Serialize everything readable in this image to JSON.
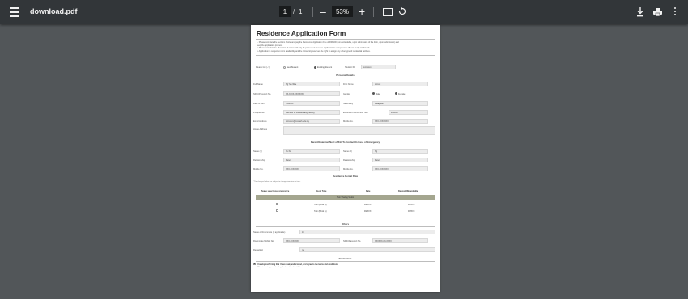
{
  "viewer": {
    "file_name": "download.pdf",
    "current_page": "1",
    "page_separator": "/",
    "total_pages": "1",
    "zoom": "53%",
    "zoom_out_symbol": "–",
    "zoom_in_symbol": "+"
  },
  "form": {
    "title": "Residence Application Form",
    "instructions": [
      "1. Please complete the sections below and pay the Residence Application Fee of RM 100 (non-refundable, upon submission of the form, upon submission) and",
      "   keep the application process.",
      "2. Please note that the allocation of rooms will only be processed once the applicant has accepted an offer to study at Monash.",
      "3. Application is subject to room availability and the University reserves the right to assign any other type of residential facilities."
    ],
    "applicant_type": {
      "label": "Please tick (✓)",
      "options": [
        "New Student",
        "Existing Student"
      ],
      "student_id_label": "Student ID",
      "student_id_value": "xxxxxxxx"
    },
    "personal": {
      "title": "Personal Details",
      "full_name_label": "Full Name",
      "full_name": "Ng Yee Wee",
      "first_name_label": "First Name",
      "first_name": "xxxxxx",
      "nric_label": "NRIC/Passport No.",
      "nric": "XX-XXXX-XXX-XXXX",
      "gender_label": "Gender",
      "gender_options": [
        "Male",
        "Female"
      ],
      "dob_label": "Date of Birth",
      "dob": "7/8/2000",
      "nationality_label": "Nationality",
      "nationality": "Malaysian",
      "programme_label": "Programme",
      "programme": "Bachelor in Software Engineering",
      "enrolment_label": "Enrolment Month and Year",
      "enrolment": "2019/16",
      "email_label": "Email Address",
      "email": "xxxxxxxx@monash.edu.my",
      "mobile_label": "Mobile No.",
      "mobile": "XXX-XXXXXXX",
      "home_label": "Home Address",
      "home": ""
    },
    "guardian": {
      "title": "Parent/Guardian/Next of Kin To Contact In Case of Emergency",
      "name1_label": "Name (1)",
      "name1": "Xx Xx",
      "name2_label": "Name (2)",
      "name2": "Ng",
      "rel1_label": "Relationship",
      "rel1": "Parent",
      "rel2_label": "Relationship",
      "rel2": "Parent",
      "mob1_label": "Mobile No.",
      "mob1": "XXX-XXXXXXX",
      "mob2_label": "Mobile No.",
      "mob2": "XXX-XXXXXXX"
    },
    "rental": {
      "title": "Residence Rental Rate",
      "note": "*The charges below are subject to change from time to time.",
      "headers": [
        "Please select your preference",
        "Room Type",
        "Rate",
        "Deposit (Refundable)"
      ],
      "band": "Twin Sharing Studio",
      "rows": [
        {
          "room": "Twin (Block G)",
          "rate": "RMXXX",
          "deposit": "RMXXX"
        },
        {
          "room": "Twin (Block G)",
          "rate": "RMXXX",
          "deposit": "RMXXX"
        }
      ]
    },
    "others": {
      "title": "Others",
      "roommate_label": "Name of Roommate (if applicable)",
      "roommate": "Ji",
      "roommate_id_label": "Roommate Mobile No.",
      "roommate_id": "XXX-XXXXXXX",
      "rm_passport_label": "NRIC/Passport No.",
      "rm_passport": "XXXXXX-XX-XXXX",
      "remarks_label": "Remark(s)",
      "remarks": "no"
    },
    "declaration": {
      "title": "Declaration",
      "text": "I hereby confirming that I have read, understood, and agree to the terms and conditions.",
      "sub": "*This student approved and applied email and installation"
    }
  }
}
